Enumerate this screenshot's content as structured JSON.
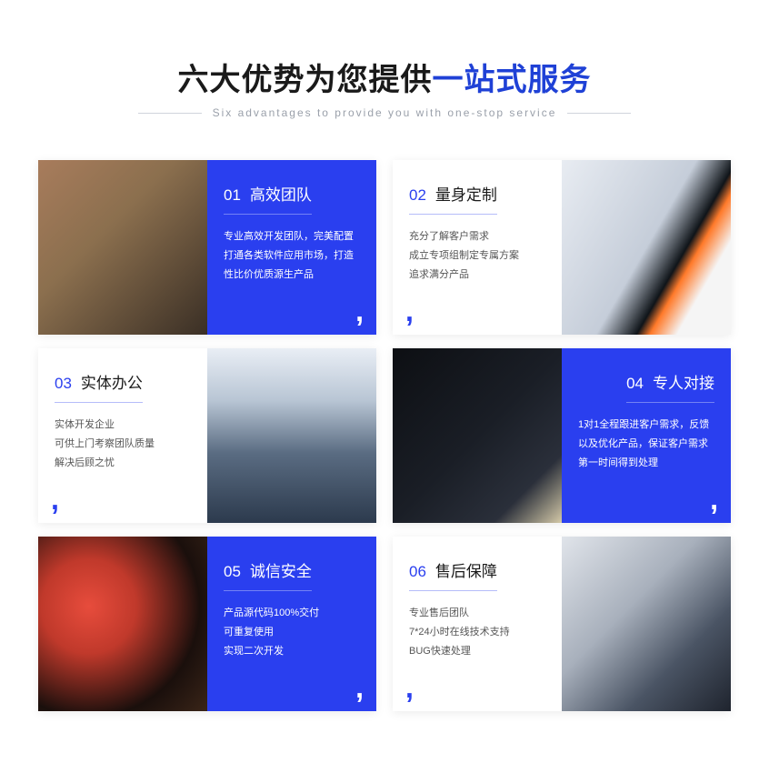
{
  "header": {
    "title_black": "六大优势为您提供",
    "title_blue": "一站式服务",
    "subtitle": "Six advantages to provide you with one-stop service"
  },
  "cards": [
    {
      "num": "01",
      "title": "高效团队",
      "desc": "专业高效开发团队，完美配置打通各类软件应用市场，打造性比价优质源生产品"
    },
    {
      "num": "02",
      "title": "量身定制",
      "desc": "充分了解客户需求\n成立专项组制定专属方案\n追求满分产品"
    },
    {
      "num": "03",
      "title": "实体办公",
      "desc": "实体开发企业\n可供上门考察团队质量\n解决后顾之忧"
    },
    {
      "num": "04",
      "title": "专人对接",
      "desc": "1对1全程跟进客户需求，反馈以及优化产品，保证客户需求第一时间得到处理"
    },
    {
      "num": "05",
      "title": "诚信安全",
      "desc": "产品源代码100%交付\n可重复使用\n实现二次开发"
    },
    {
      "num": "06",
      "title": "售后保障",
      "desc": "专业售后团队\n7*24小时在线技术支持\nBUG快速处理"
    }
  ]
}
